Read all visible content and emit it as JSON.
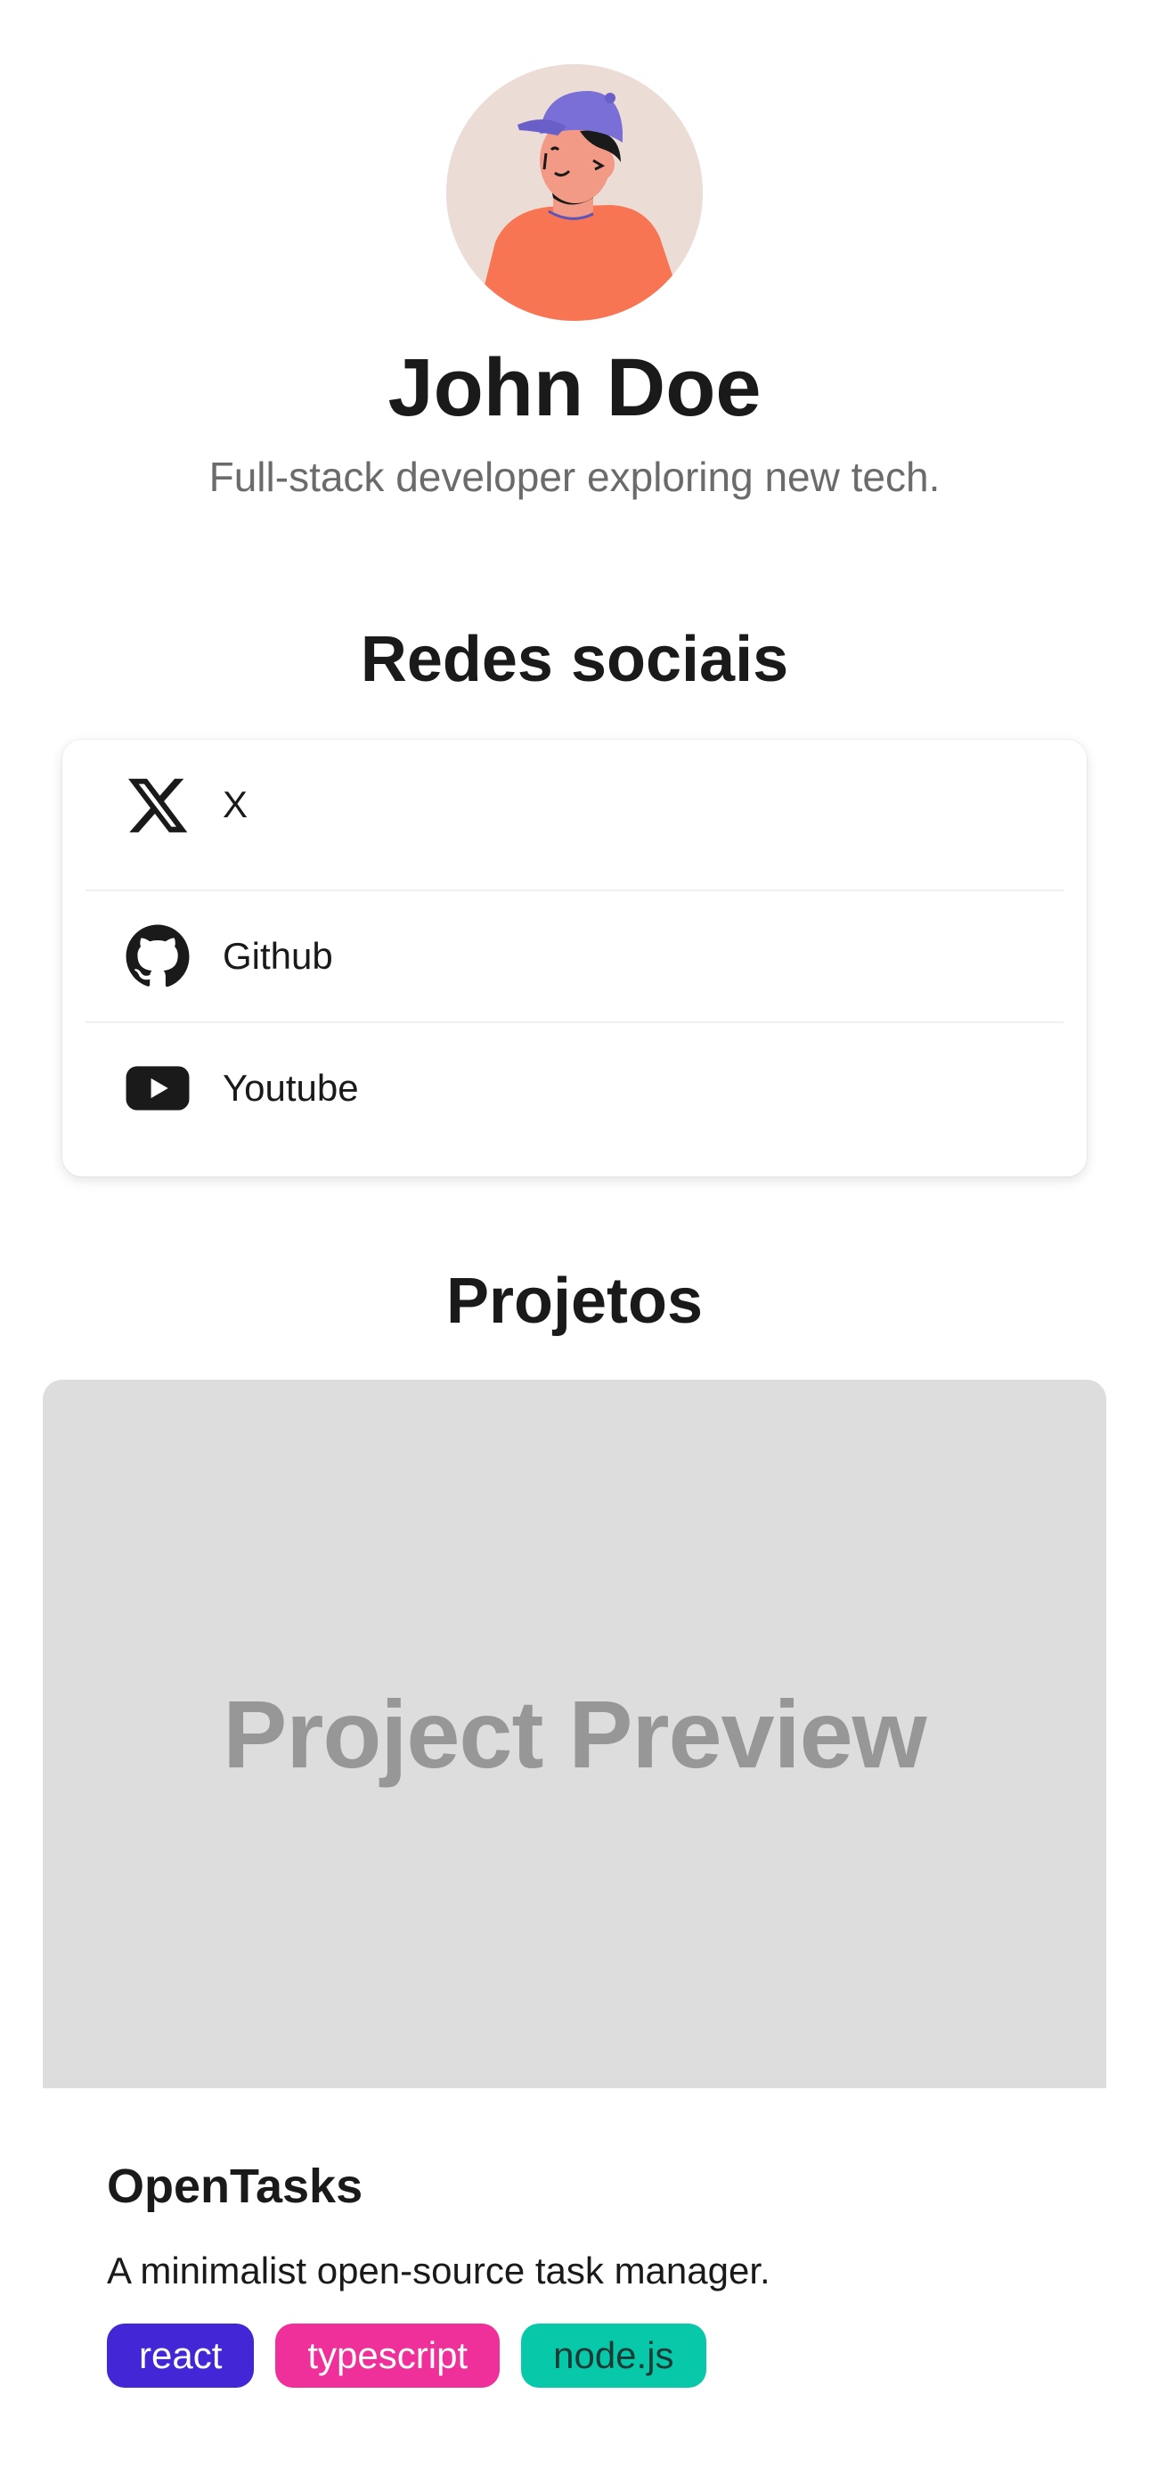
{
  "profile": {
    "name": "John Doe",
    "bio": "Full-stack developer exploring new tech."
  },
  "social": {
    "title": "Redes sociais",
    "items": [
      {
        "label": "X",
        "icon": "x-logo-icon"
      },
      {
        "label": "Github",
        "icon": "github-icon"
      },
      {
        "label": "Youtube",
        "icon": "youtube-icon"
      }
    ]
  },
  "projects": {
    "title": "Projetos",
    "items": [
      {
        "preview_text": "Project Preview",
        "title": "OpenTasks",
        "description": "A minimalist open-source task manager.",
        "tags": [
          {
            "label": "react",
            "bg": "#4327d6",
            "fg": "#ffffff"
          },
          {
            "label": "typescript",
            "bg": "#f0309a",
            "fg": "#ffffff"
          },
          {
            "label": "node.js",
            "bg": "#07c9a9",
            "fg": "#1a3a36"
          }
        ]
      }
    ]
  }
}
